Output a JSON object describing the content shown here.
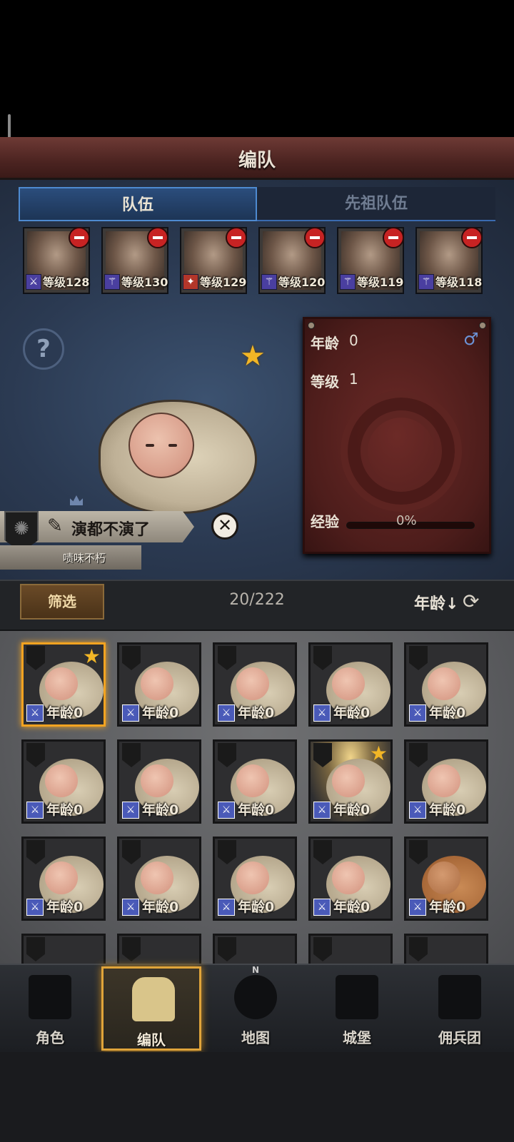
{
  "header": {
    "title": "编队"
  },
  "tabs": {
    "team": "队伍",
    "ancestor_team": "先祖队伍"
  },
  "team_slots": [
    {
      "level": "等级128",
      "class_icon": "sword-icon"
    },
    {
      "level": "等级130",
      "class_icon": "staff-icon"
    },
    {
      "level": "等级129",
      "class_icon": "tome-icon"
    },
    {
      "level": "等级120",
      "class_icon": "staff-icon"
    },
    {
      "level": "等级119",
      "class_icon": "staff-icon"
    },
    {
      "level": "等级118",
      "class_icon": "staff-icon"
    }
  ],
  "hero": {
    "name": "演都不演了",
    "trait": "啧味不朽",
    "star_rating": 1
  },
  "stats": {
    "age_label": "年龄",
    "age_value": "0",
    "level_label": "等级",
    "level_value": "1",
    "exp_label": "经验",
    "exp_value": "0%",
    "gender_icon": "male-icon"
  },
  "filter": {
    "button": "筛选",
    "count": "20/222",
    "sort": "年龄↓"
  },
  "roster": [
    {
      "age": "年龄0",
      "starred": true,
      "selected": true
    },
    {
      "age": "年龄0"
    },
    {
      "age": "年龄0"
    },
    {
      "age": "年龄0"
    },
    {
      "age": "年龄0"
    },
    {
      "age": "年龄0"
    },
    {
      "age": "年龄0"
    },
    {
      "age": "年龄0"
    },
    {
      "age": "年龄0",
      "starred": true
    },
    {
      "age": "年龄0"
    },
    {
      "age": "年龄0"
    },
    {
      "age": "年龄0"
    },
    {
      "age": "年龄0"
    },
    {
      "age": "年龄0"
    },
    {
      "age": "年龄0",
      "tan": true
    }
  ],
  "nav": {
    "character": "角色",
    "formation": "编队",
    "map": "地图",
    "map_compass": "N",
    "castle": "城堡",
    "mercenary": "佣兵团"
  }
}
